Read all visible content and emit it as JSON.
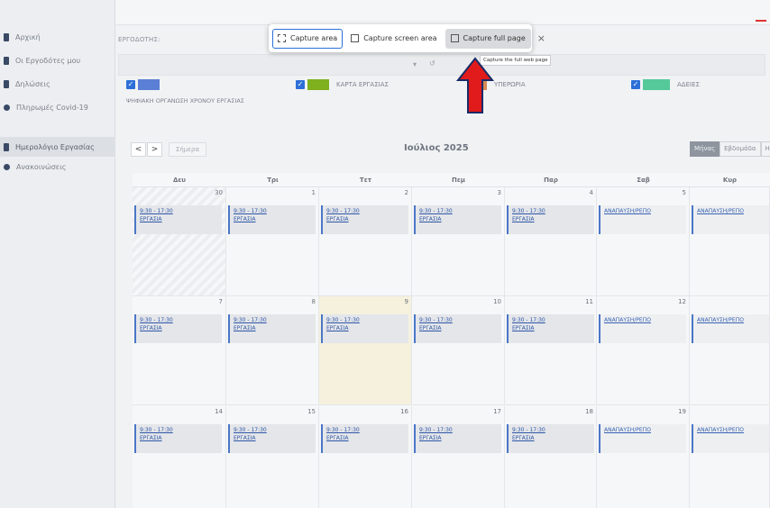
{
  "sidebar": {
    "items": [
      {
        "label": "Αρχική",
        "icon": "home-icon"
      },
      {
        "label": "Οι Εργοδότες μου",
        "icon": "building-icon"
      },
      {
        "label": "Δηλώσεις",
        "icon": "document-icon"
      },
      {
        "label": "Πληρωμές Covid-19",
        "icon": "euro-icon"
      },
      {
        "label": "Ημερολόγιο Εργασίας",
        "icon": "calendar-icon"
      },
      {
        "label": "Ανακοινώσεις",
        "icon": "megaphone-icon"
      }
    ],
    "active_index": 4
  },
  "employer": {
    "label": "ΕΡΓΟΔΟΤΗΣ:"
  },
  "legend": [
    {
      "text": "",
      "color": "#5b7fd4"
    },
    {
      "text": "ΚΑΡΤΑ ΕΡΓΑΣΙΑΣ",
      "color": "#7fb01e"
    },
    {
      "text": "ΥΠΕΡΩΡΙΑ",
      "color": "#d88a55"
    },
    {
      "text": "ΑΔΕΙΕΣ",
      "color": "#55c99a"
    }
  ],
  "legend_sub": "ΨΗΦΙΑΚΗ ΟΡΓΑΝΩΣΗ ΧΡΟΝΟΥ ΕΡΓΑΣΙΑΣ",
  "toolbar": {
    "prev": "<",
    "next": ">",
    "today": "Σήμερα",
    "title": "Ιούλιος 2025",
    "views": [
      "Μήνας",
      "Εβδομάδα",
      "Ημ"
    ],
    "active_view": 0
  },
  "calendar": {
    "weekdays": [
      "Δευ",
      "Τρι",
      "Τετ",
      "Πεμ",
      "Παρ",
      "Σαβ",
      "Κυρ"
    ],
    "weeks": [
      {
        "days": [
          "30",
          "1",
          "2",
          "3",
          "4",
          "5",
          ""
        ]
      },
      {
        "days": [
          "7",
          "8",
          "9",
          "10",
          "11",
          "12",
          ""
        ]
      },
      {
        "days": [
          "14",
          "15",
          "16",
          "17",
          "18",
          "19",
          ""
        ]
      }
    ],
    "work_time": "9:30 - 17:30",
    "work_label": "ΕΡΓΑΣΙΑ",
    "rest_label": "ΑΝΑΠΑΥΣΗ/ΡΕΠΟ"
  },
  "capture": {
    "area": "Capture area",
    "screen": "Capture screen area",
    "full": "Capture full page",
    "close": "×",
    "tooltip": "Capture the full web page"
  },
  "colors": {
    "arrow": "#e11b1b",
    "accent": "#2d6fd8"
  }
}
